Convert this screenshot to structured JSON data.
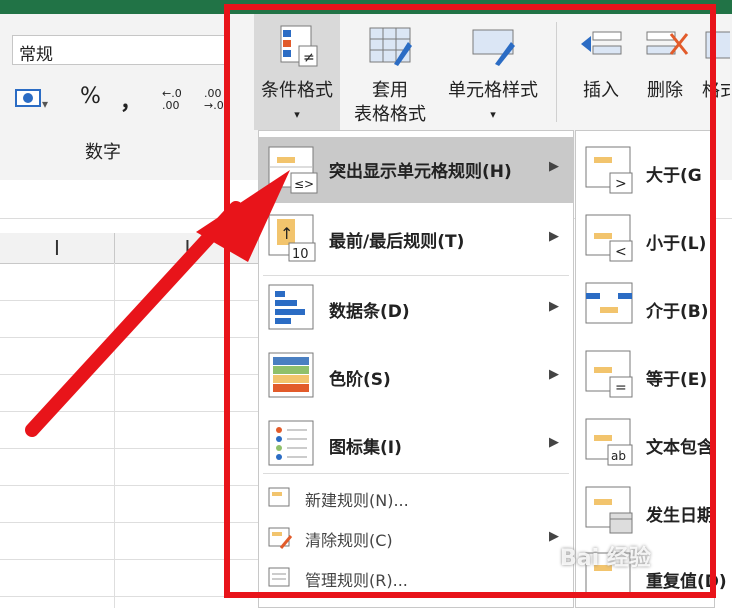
{
  "ribbon": {
    "number_format": "常规",
    "percent": "%",
    "comma": "，",
    "inc_decimal": "←.0 .00",
    "dec_decimal": ".00 →.0",
    "group_label": "数字"
  },
  "columns": [
    "I",
    "J"
  ],
  "buttons": {
    "conditional_format": "条件格式",
    "table_format_line1": "套用",
    "table_format_line2": "表格格式",
    "cell_styles": "单元格样式",
    "insert": "插入",
    "delete": "删除",
    "format_partial": "格式"
  },
  "menu": {
    "items": [
      {
        "label": "突出显示单元格规则(H)"
      },
      {
        "label": "最前/最后规则(T)"
      },
      {
        "label": "数据条(D)"
      },
      {
        "label": "色阶(S)"
      },
      {
        "label": "图标集(I)"
      }
    ],
    "small_items": [
      {
        "label": "新建规则(N)..."
      },
      {
        "label": "清除规则(C)"
      },
      {
        "label": "管理规则(R)..."
      }
    ]
  },
  "submenu": {
    "items": [
      {
        "label": "大于(G"
      },
      {
        "label": "小于(L)"
      },
      {
        "label": "介于(B)"
      },
      {
        "label": "等于(E)"
      },
      {
        "label": "文本包含"
      },
      {
        "label": "发生日期"
      },
      {
        "label": "重复值(D)"
      }
    ]
  },
  "watermark": "Bai 经验",
  "colors": {
    "highlight_frame": "#e8141a",
    "arrow": "#e8141a",
    "menu_selected": "#c9c9c9"
  }
}
